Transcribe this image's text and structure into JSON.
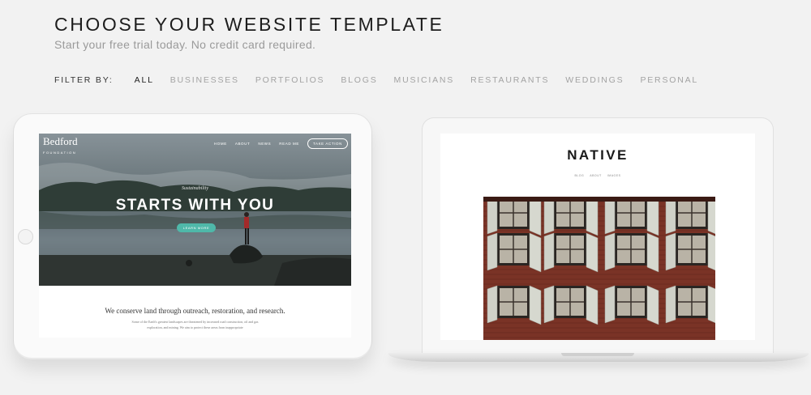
{
  "header": {
    "title": "CHOOSE YOUR WEBSITE TEMPLATE",
    "subtitle": "Start your free trial today. No credit card required."
  },
  "filter": {
    "label": "FILTER BY:",
    "items": [
      "ALL",
      "BUSINESSES",
      "PORTFOLIOS",
      "BLOGS",
      "MUSICIANS",
      "RESTAURANTS",
      "WEDDINGS",
      "PERSONAL"
    ],
    "active": "ALL"
  },
  "templates": [
    {
      "device": "tablet",
      "logo_main": "Bedford",
      "logo_sub": "FOUNDATION",
      "nav": [
        "HOME",
        "ABOUT",
        "NEWS",
        "READ ME"
      ],
      "cta": "TAKE ACTION",
      "kicker": "Sustainability",
      "headline": "STARTS WITH YOU",
      "button": "LEARN MORE",
      "tagline": "We conserve land through outreach, restoration, and research.",
      "paragraph": "Some of the Earth's greatest landscapes are threatened by increased road construction, oil and gas exploration, and mining. We aim to protect these areas from inappropriate"
    },
    {
      "device": "laptop",
      "title": "NATIVE",
      "nav": [
        "BLOG",
        "ABOUT",
        "IMAGES"
      ]
    }
  ],
  "colors": {
    "background": "#f2f2f2",
    "accent_button": "#4fb8a9",
    "filter_active": "#222222",
    "filter_inactive": "#a3a3a3"
  }
}
